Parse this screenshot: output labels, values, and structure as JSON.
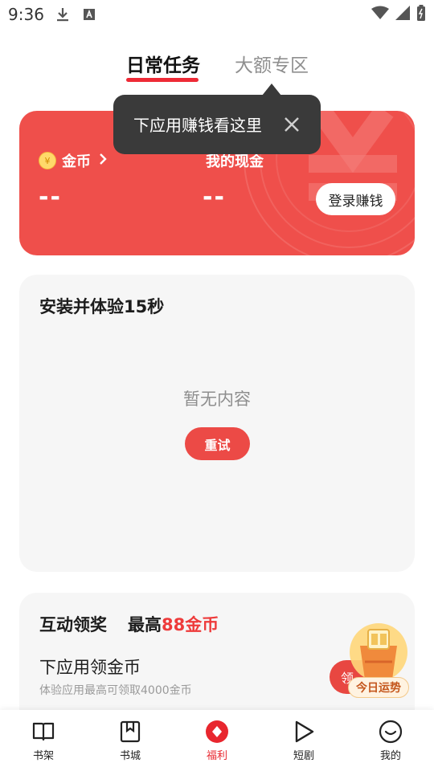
{
  "status_bar": {
    "time": "9:36"
  },
  "tabs": [
    {
      "label": "日常任务",
      "active": true
    },
    {
      "label": "大额专区",
      "active": false
    }
  ],
  "tooltip": {
    "text": "下应用赚钱看这里"
  },
  "wallet": {
    "coins_label": "金币",
    "coins_value": "--",
    "cash_label": "我的现金",
    "cash_value": "--",
    "login_button": "登录赚钱"
  },
  "install_card": {
    "title": "安装并体验15秒",
    "empty_text": "暂无内容",
    "retry_button": "重试"
  },
  "interactive_card": {
    "title": "互动领奖",
    "max_prefix": "最高",
    "max_value": "88金币",
    "subtitle": "下应用领金币",
    "description": "体验应用最高可领取4000金币",
    "claim_button": "领",
    "fortune_label": "今日运势"
  },
  "bottom_nav": [
    {
      "label": "书架",
      "icon": "book-open-icon",
      "active": false
    },
    {
      "label": "书城",
      "icon": "bookmark-book-icon",
      "active": false
    },
    {
      "label": "福利",
      "icon": "gift-circle-icon",
      "active": true
    },
    {
      "label": "短剧",
      "icon": "play-icon",
      "active": false
    },
    {
      "label": "我的",
      "icon": "smile-face-icon",
      "active": false
    }
  ],
  "colors": {
    "accent": "#e8262e",
    "card_red": "#ef4f4b",
    "tooltip_bg": "#3a3a3a"
  }
}
